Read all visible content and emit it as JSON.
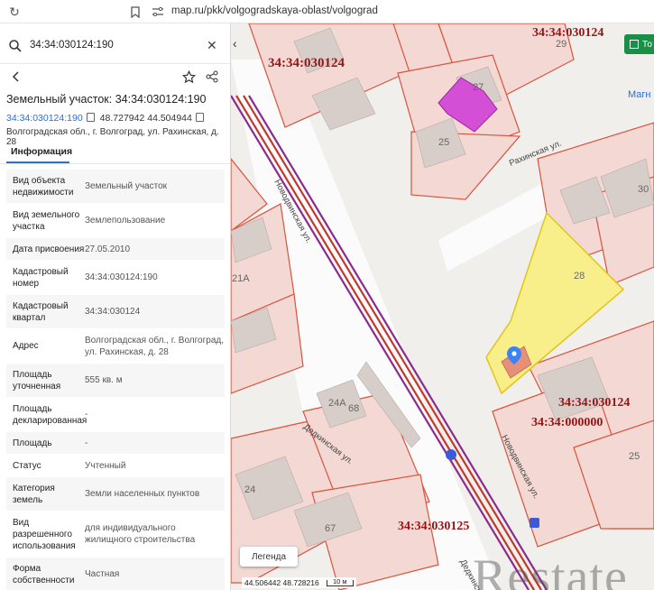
{
  "browser": {
    "url": "map.ru/pkk/volgogradskaya-oblast/volgograd"
  },
  "search": {
    "value": "34:34:030124:190"
  },
  "card": {
    "title": "Земельный участок: 34:34:030124:190",
    "cadastral_link": "34:34:030124:190",
    "coordinates": "48.727942 44.504944",
    "address": "Волгоградская обл., г. Волгоград, ул. Рахинская, д. 28",
    "tab": "Информация"
  },
  "rows": [
    {
      "k": "Вид объекта недвижимости",
      "v": "Земельный участок"
    },
    {
      "k": "Вид земельного участка",
      "v": "Землепользование"
    },
    {
      "k": "Дата присвоения",
      "v": "27.05.2010"
    },
    {
      "k": "Кадастровый номер",
      "v": "34:34:030124:190"
    },
    {
      "k": "Кадастровый квартал",
      "v": "34:34:030124"
    },
    {
      "k": "Адрес",
      "v": "Волгоградская обл., г. Волгоград, ул. Рахинская, д. 28"
    },
    {
      "k": "Площадь уточненная",
      "v": "555 кв. м"
    },
    {
      "k": "Площадь декларированная",
      "v": "-"
    },
    {
      "k": "Площадь",
      "v": "-"
    },
    {
      "k": "Статус",
      "v": "Учтенный"
    },
    {
      "k": "Категория земель",
      "v": "Земли населенных пунктов"
    },
    {
      "k": "Вид разрешенного использования",
      "v": "для индивидуального жилищного строительства"
    },
    {
      "k": "Форма собственности",
      "v": "Частная"
    }
  ],
  "map": {
    "quarter_labels": [
      "34:34:030124",
      "34:34:030124",
      "34:34:030124",
      "34:34:000000",
      "34:34:030125"
    ],
    "house_numbers": [
      "29",
      "27",
      "25",
      "30",
      "28",
      "21А",
      "24А",
      "68",
      "24",
      "67",
      "25"
    ],
    "streets": [
      "Рахинская ул.",
      "Новодвинская ул.",
      "Дедкинская ул.",
      "Новодвинская ул.",
      "Дедкинская ул."
    ],
    "poi": "Магн",
    "layers_button": "То",
    "legend": "Легенда",
    "scale_coords": "44.506442  48.728216",
    "scale_label": "10 м",
    "watermark": "Restate"
  },
  "colors": {
    "accent": "#2a6fd6",
    "parcel_border": "#d9533d",
    "parcel_fill": "#f3d8d3",
    "selected_parcel": "#f9ef8a",
    "building_magenta": "#d24fd6",
    "rail_purple": "#8b2a8f"
  }
}
